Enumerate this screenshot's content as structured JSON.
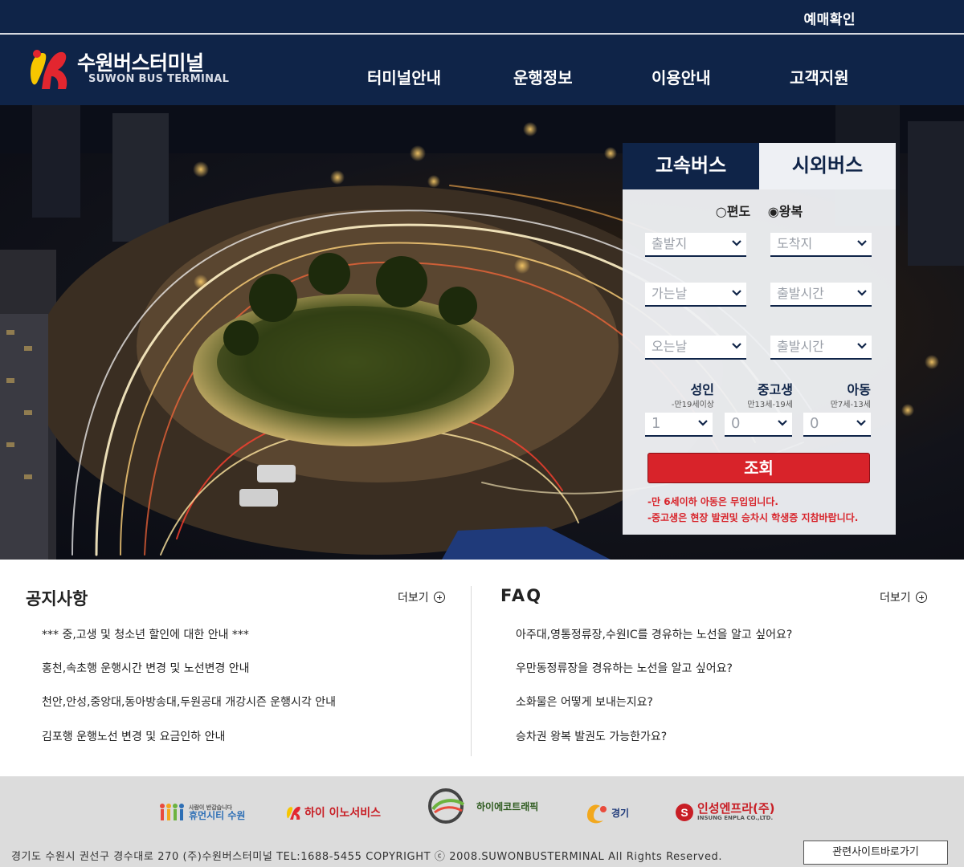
{
  "topbar": {
    "reserve_check": "예매확인"
  },
  "header": {
    "logo_ko": "수원버스터미널",
    "logo_en": "SUWON BUS TERMINAL",
    "nav": [
      "터미널안내",
      "운행정보",
      "이용안내",
      "고객지원"
    ]
  },
  "booking": {
    "tabs": [
      "고속버스",
      "시외버스"
    ],
    "trip_type": {
      "one_way": "○편도",
      "round_trip": "◉왕복"
    },
    "fields": {
      "departure": "출발지",
      "arrival": "도착지",
      "go_date": "가는날",
      "go_time": "출발시간",
      "return_date": "오는날",
      "return_time": "출발시간"
    },
    "passengers": [
      {
        "title": "성인",
        "sub": "-만19세이상",
        "value": "1"
      },
      {
        "title": "중고생",
        "sub": "만13세-19세",
        "value": "0"
      },
      {
        "title": "아동",
        "sub": "만7세-13세",
        "value": "0"
      }
    ],
    "search_label": "조회",
    "notes": [
      "-만 6세이하 아동은 무입입니다.",
      "-중고생은 현장 발권및 승차시 학생증 지참바랍니다."
    ],
    "accent_color": "#d8232a",
    "navy_color": "#0f2448"
  },
  "notice": {
    "title": "공지사항",
    "more": "더보기",
    "items": [
      "*** 중,고생 및 청소년 할인에 대한 안내 ***",
      "홍천,속초행 운행시간 변경 및 노선변경 안내",
      "천안,안성,중앙대,동아방송대,두원공대 개강시즌 운행시각 안내",
      "김포행 운행노선 변경 및 요금인하 안내"
    ]
  },
  "faq": {
    "title": "FAQ",
    "more": "더보기",
    "items": [
      "아주대,영통정류장,수원IC를 경유하는 노선을 알고 싶어요?",
      "우만동정류장을 경유하는 노선을 알고 싶어요?",
      "소화물은 어떻게 보내는지요?",
      "승차권 왕복 발권도 가능한가요?"
    ]
  },
  "footer": {
    "partners": [
      {
        "name": "휴먼시티 수원",
        "tagline": "사람이 반갑습니다",
        "icon": "human-city-suwon-logo"
      },
      {
        "name": "하이 이노서비스",
        "icon": "hi-innoservice-logo"
      },
      {
        "name": "하이에코트래픽",
        "icon": "hi-ecotraffic-logo"
      },
      {
        "name": "경기",
        "icon": "gyeonggi-logo"
      },
      {
        "name": "인성엔프라(주)",
        "sub": "INSUNG ENPLA CO.,LTD.",
        "icon": "insung-enpla-logo"
      }
    ],
    "copyright": "경기도 수원시 권선구 경수대로 270 (주)수원버스터미널 TEL:1688-5455   COPYRIGHT ⓒ 2008.SUWONBUSTERMINAL All Rights Reserved.",
    "related_sites": "관련사이트바로가기"
  }
}
